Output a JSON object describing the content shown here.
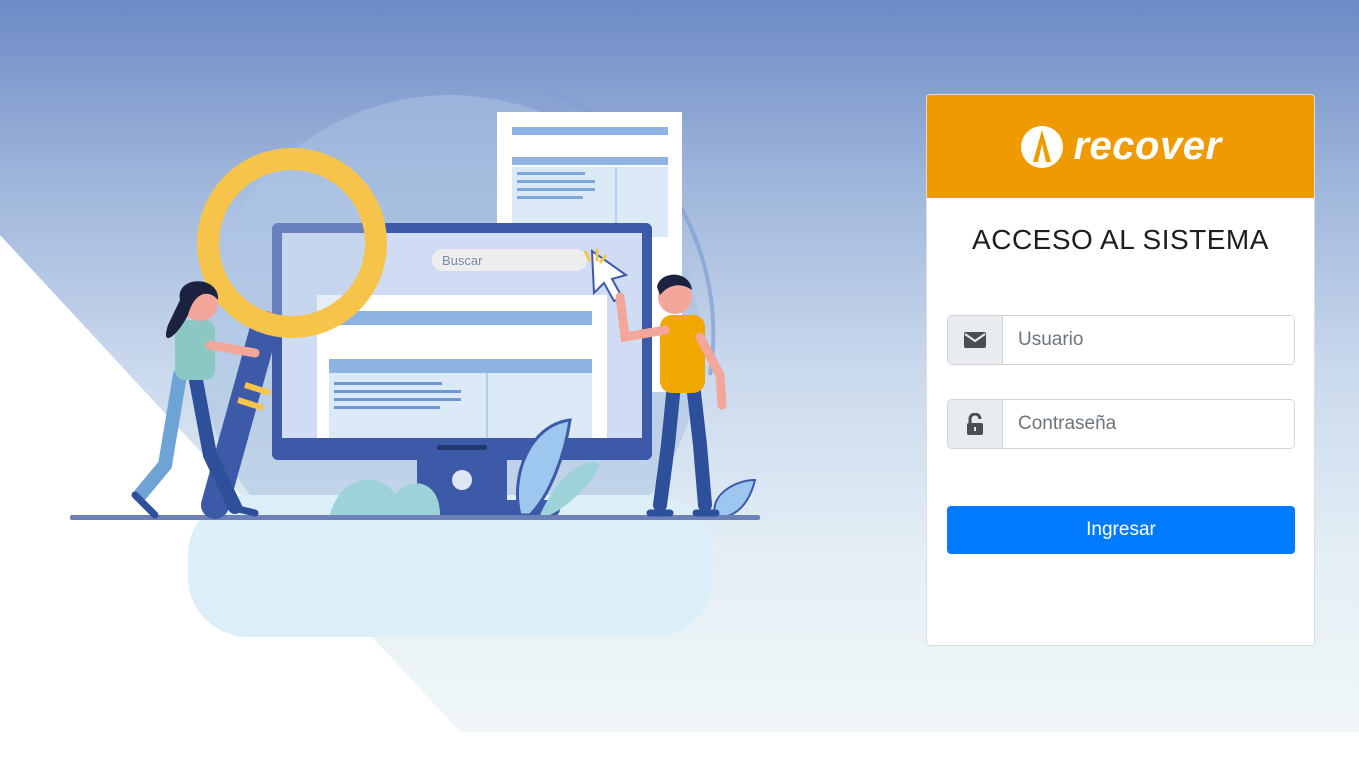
{
  "brand": {
    "name": "recover",
    "header_color": "#ef9a00"
  },
  "login": {
    "title": "ACCESO AL SISTEMA",
    "username": {
      "placeholder": "Usuario",
      "value": "",
      "icon": "envelope-icon"
    },
    "password": {
      "placeholder": "Contraseña",
      "value": "",
      "icon": "lock-open-icon"
    },
    "submit_label": "Ingresar",
    "submit_color": "#007bff"
  },
  "illustration": {
    "search_placeholder": "Buscar"
  }
}
